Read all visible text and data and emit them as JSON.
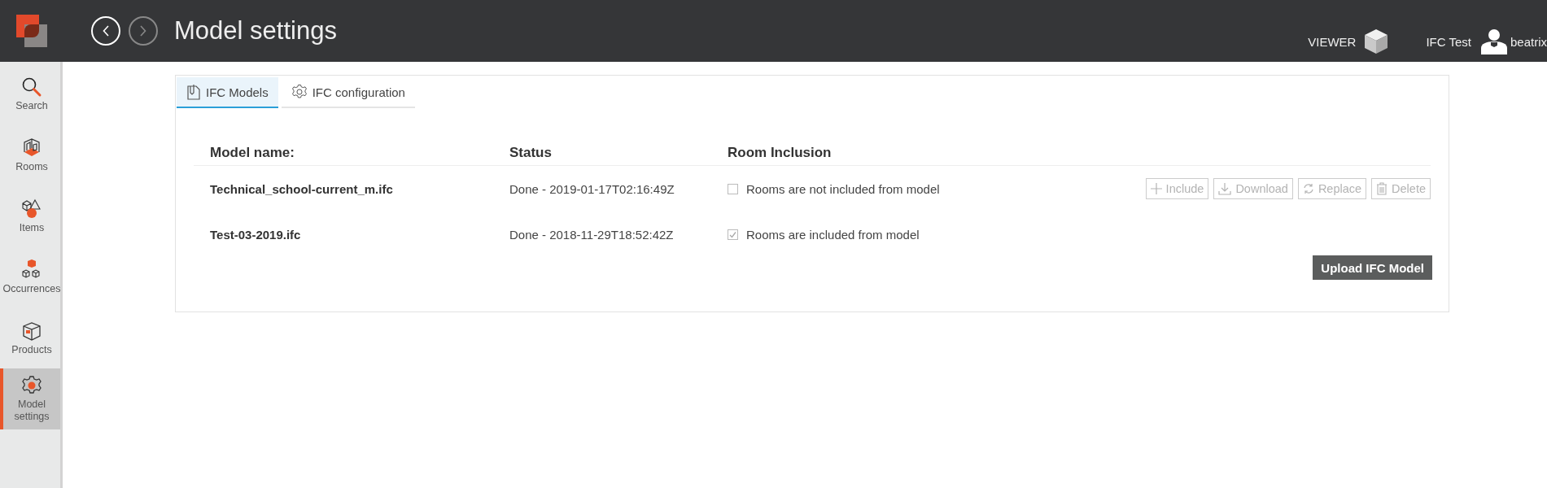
{
  "header": {
    "title": "Model settings",
    "nav": [
      {
        "kind": "back",
        "disabled": false
      },
      {
        "kind": "forward",
        "disabled": true
      }
    ],
    "viewer_label": "VIEWER",
    "project": "IFC Test",
    "user": "beatrix"
  },
  "sidebar": {
    "items": [
      {
        "label": "Search",
        "kind": "search",
        "selected": false
      },
      {
        "label": "Rooms",
        "kind": "rooms",
        "selected": false
      },
      {
        "label": "Items",
        "kind": "items",
        "selected": false
      },
      {
        "label": "Occurrences",
        "kind": "occurrences",
        "selected": false
      },
      {
        "label": "Products",
        "kind": "products",
        "selected": false
      },
      {
        "label": "Model settings",
        "kind": "gear",
        "selected": true
      }
    ]
  },
  "tabs": [
    {
      "label": "IFC Models",
      "kind": "models",
      "selected": true
    },
    {
      "label": "IFC configuration",
      "kind": "gear",
      "selected": false
    }
  ],
  "table": {
    "columns": [
      "Model name:",
      "Status",
      "Room Inclusion"
    ],
    "rows": [
      {
        "name": "Technical_school-current_m.ifc",
        "status": "Done - 2019-01-17T02:16:49Z",
        "inclusion": "Rooms are not included from model",
        "checked": false,
        "actions": [
          {
            "label": "Include",
            "kind": "plus",
            "disabled": true
          },
          {
            "label": "Download",
            "kind": "download",
            "disabled": true
          },
          {
            "label": "Replace",
            "kind": "replace",
            "disabled": true
          },
          {
            "label": "Delete",
            "kind": "trash",
            "disabled": true
          }
        ]
      },
      {
        "name": "Test-03-2019.ifc",
        "status": "Done - 2018-11-29T18:52:42Z",
        "inclusion": "Rooms are included from model",
        "checked": true,
        "actions": []
      }
    ]
  },
  "upload_button": "Upload IFC Model"
}
